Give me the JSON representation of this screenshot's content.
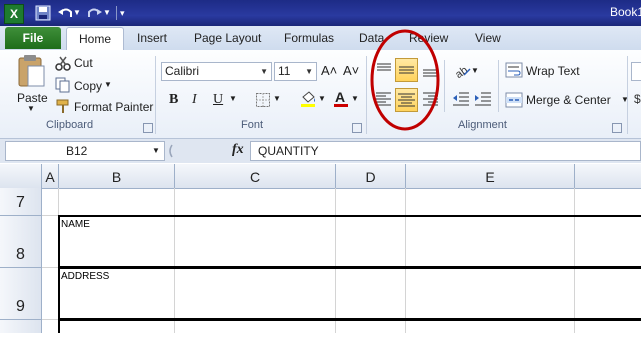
{
  "window": {
    "title": "Book1"
  },
  "tabs": {
    "file": "File",
    "home": "Home",
    "insert": "Insert",
    "page_layout": "Page Layout",
    "formulas": "Formulas",
    "data": "Data",
    "review": "Review",
    "view": "View"
  },
  "clipboard": {
    "paste": "Paste",
    "cut": "Cut",
    "copy": "Copy",
    "format_painter": "Format Painter",
    "label": "Clipboard"
  },
  "font": {
    "name": "Calibri",
    "size": "11",
    "grow_icon": "A˄",
    "shrink_icon": "A˅",
    "bold": "B",
    "italic": "I",
    "underline": "U",
    "label": "Font",
    "font_color": "#cc0000",
    "fill_color": "#ffff00"
  },
  "alignment": {
    "wrap_text": "Wrap Text",
    "merge_center": "Merge & Center",
    "label": "Alignment",
    "highlight_color": "#c00000"
  },
  "formula_bar": {
    "name_box": "B12",
    "fx": "fx",
    "content": "QUANTITY"
  },
  "grid": {
    "columns": [
      "A",
      "B",
      "C",
      "D",
      "E"
    ],
    "rows": [
      "7",
      "8",
      "9"
    ],
    "cells": {
      "b8": "NAME",
      "b9": "ADDRESS"
    }
  },
  "colors": {
    "title_bar": "#1d2b86",
    "file_tab": "#2a7a25",
    "selected_button": "#ffd35c"
  }
}
